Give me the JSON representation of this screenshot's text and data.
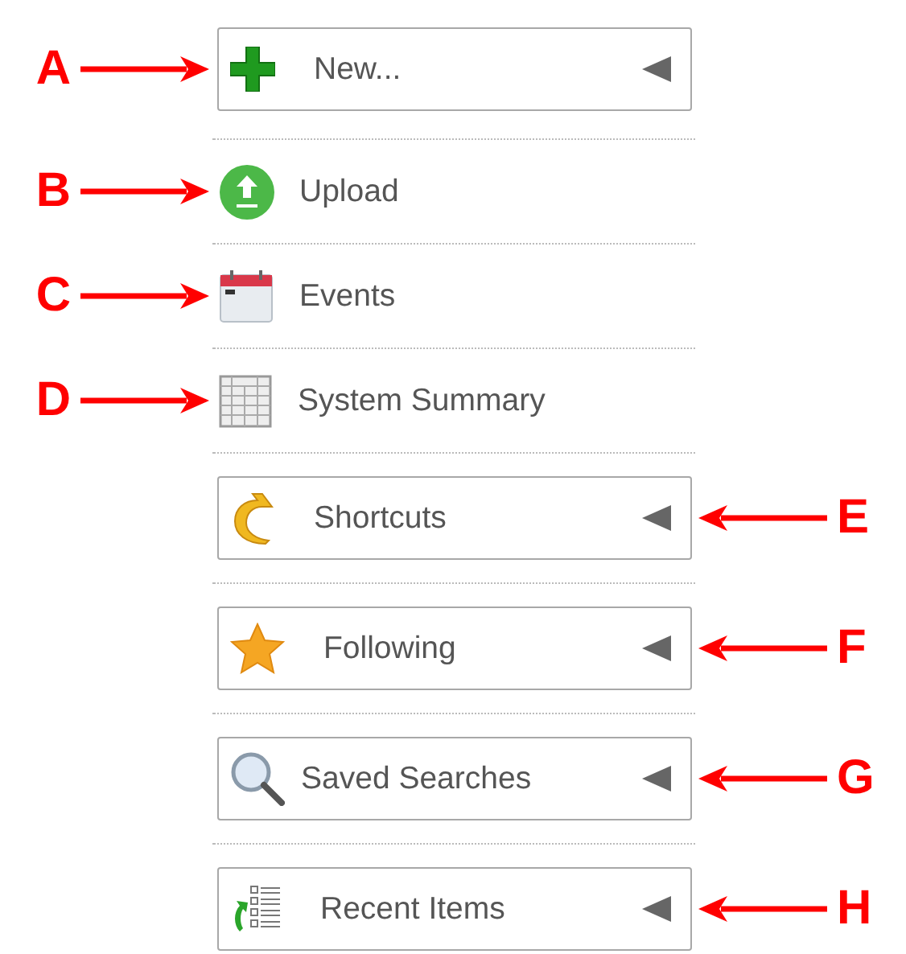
{
  "menu": [
    {
      "kind": "dropdown",
      "label": "New...",
      "callout": "A",
      "callout_on_right": false
    },
    {
      "kind": "link",
      "label": "Upload",
      "callout": "B",
      "callout_on_right": false
    },
    {
      "kind": "link",
      "label": "Events",
      "callout": "C",
      "callout_on_right": false
    },
    {
      "kind": "link",
      "label": "System Summary",
      "callout": "D",
      "callout_on_right": false
    },
    {
      "kind": "dropdown",
      "label": "Shortcuts",
      "callout": "E",
      "callout_on_right": true
    },
    {
      "kind": "dropdown",
      "label": "Following",
      "callout": "F",
      "callout_on_right": true
    },
    {
      "kind": "dropdown",
      "label": "Saved Searches",
      "callout": "G",
      "callout_on_right": true
    },
    {
      "kind": "dropdown",
      "label": "Recent Items",
      "callout": "H",
      "callout_on_right": true
    }
  ]
}
